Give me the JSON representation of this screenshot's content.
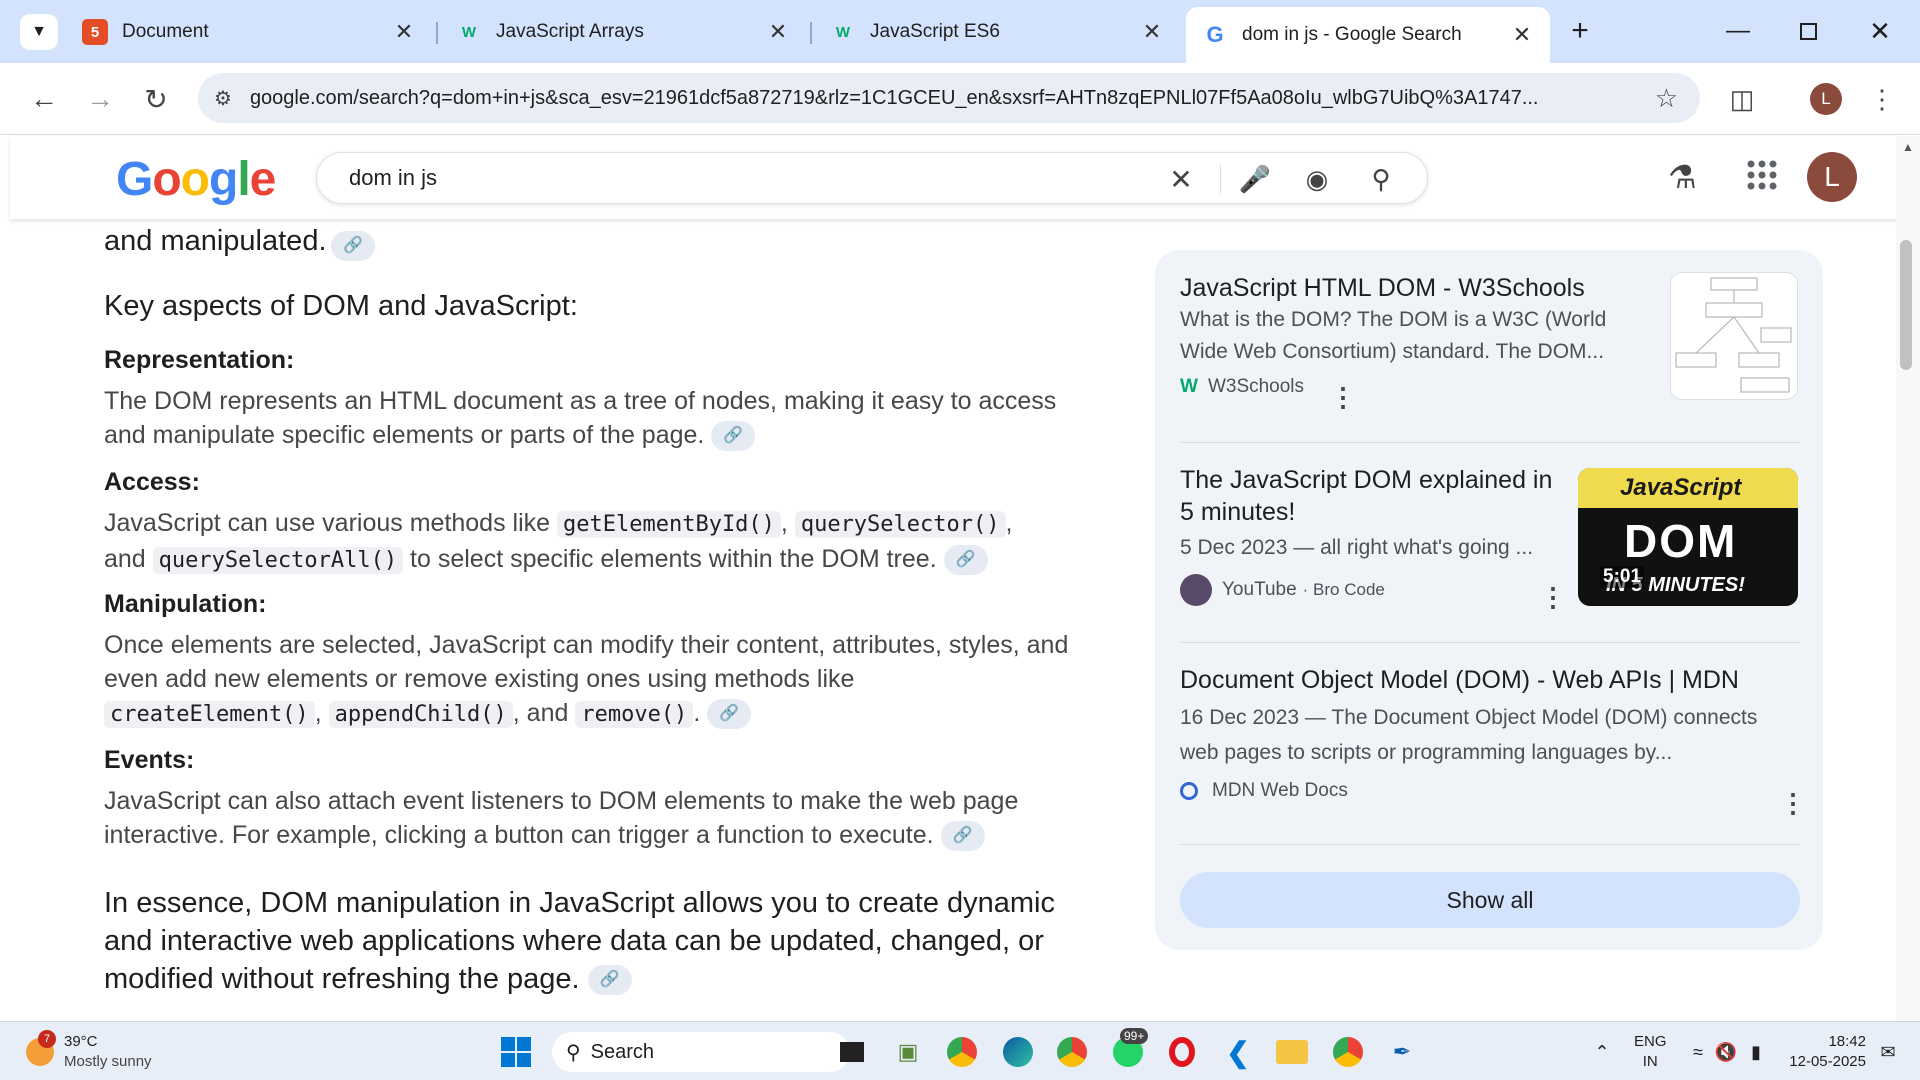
{
  "browser": {
    "tabs": [
      {
        "title": "Document",
        "icon": "html-file-icon",
        "active": false
      },
      {
        "title": "JavaScript Arrays",
        "icon": "w3schools-icon",
        "active": false
      },
      {
        "title": "JavaScript ES6",
        "icon": "w3schools-icon",
        "active": false
      },
      {
        "title": "dom in js - Google Search",
        "icon": "google-icon",
        "active": true
      }
    ],
    "new_tab": "+",
    "url": "google.com/search?q=dom+in+js&sca_esv=21961dcf5a872719&rlz=1C1GCEU_en&sxsrf=AHTn8zqEPNLl07Ff5Aa08oIu_wlbG7UibQ%3A1747...",
    "profile_initial": "L"
  },
  "google": {
    "logo": "Google",
    "query": "dom in js",
    "avatar_initial": "L"
  },
  "content": {
    "top_line": "and manipulated.",
    "heading": "Key aspects of DOM and JavaScript:",
    "rep_title": "Representation:",
    "rep_body": "The DOM represents an HTML document as a tree of nodes, making it easy to access and manipulate specific elements or parts of the page.",
    "access_title": "Access:",
    "access_1": "JavaScript can use various methods like ",
    "access_code1": "getElementById()",
    "access_sep1": ", ",
    "access_code2": "querySelector()",
    "access_sep2": ",",
    "access_and": "and ",
    "access_code3": "querySelectorAll()",
    "access_2": " to select specific elements within the DOM tree.",
    "manip_title": "Manipulation:",
    "manip_1": "Once elements are selected, JavaScript can modify their content, attributes, styles, and even add new elements or remove existing ones using methods like",
    "manip_code1": "createElement()",
    "manip_sep1": ", ",
    "manip_code2": "appendChild()",
    "manip_sep2": ", and ",
    "manip_code3": "remove()",
    "manip_end": ".",
    "events_title": "Events:",
    "events_body": "JavaScript can also attach event listeners to DOM elements to make the web page interactive. For example, clicking a button can trigger a function to execute.",
    "essence": "In essence, DOM manipulation in JavaScript allows you to create dynamic and interactive web applications where data can be updated, changed, or modified without refreshing the page."
  },
  "sidebar": {
    "results": [
      {
        "title": "JavaScript HTML DOM - W3Schools",
        "snippet": "What is the DOM? The DOM is a W3C (World Wide Web Consortium) standard. The DOM...",
        "source": "W3Schools"
      },
      {
        "title": "The JavaScript DOM explained in 5 minutes!",
        "snippet": "5 Dec 2023 — all right what's going ...",
        "source": "YouTube",
        "channel": "· Bro Code",
        "duration": "5:01",
        "thumb_text": "JavaScript",
        "thumb_dom": "DOM",
        "thumb_bottom": "IN 5 MINUTES!"
      },
      {
        "title": "Document Object Model (DOM) - Web APIs | MDN",
        "snippet": "16 Dec 2023 — The Document Object Model (DOM) connects web pages to scripts or programming languages by...",
        "source": "MDN Web Docs"
      }
    ],
    "show_all": "Show all"
  },
  "taskbar": {
    "weather_badge": "7",
    "temp": "39°C",
    "weather": "Mostly sunny",
    "search": "Search",
    "whatsapp_badge": "99+",
    "lang1": "ENG",
    "lang2": "IN",
    "time": "18:42",
    "date": "12-05-2025"
  },
  "colors": {
    "accent": "#d3e3fd",
    "panel": "#f0f4f9",
    "avatar": "#8a4b3d"
  }
}
